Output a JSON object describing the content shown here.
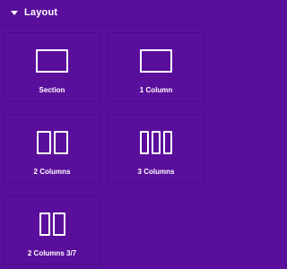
{
  "section": {
    "title": "Layout",
    "collapse_icon": "caret-down-icon"
  },
  "elements": [
    {
      "label": "Section",
      "icon": "section-layout-icon"
    },
    {
      "label": "1 Column",
      "icon": "one-column-icon"
    },
    {
      "label": "2 Columns",
      "icon": "two-columns-icon"
    },
    {
      "label": "3 Columns",
      "icon": "three-columns-icon"
    },
    {
      "label": "2 Columns 3/7",
      "icon": "two-columns-3-7-icon"
    }
  ],
  "colors": {
    "panel_background": "#5a0f9c",
    "card_border": "#4c0a8a",
    "text": "#ffffff"
  }
}
